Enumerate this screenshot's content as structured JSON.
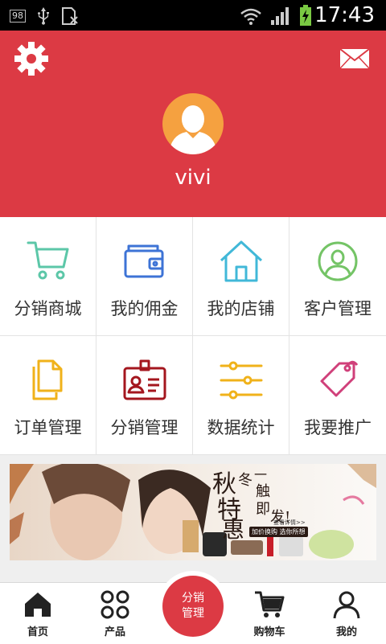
{
  "status_bar": {
    "time": "17:43",
    "notification_badge": "98"
  },
  "header": {
    "username": "vivi",
    "settings_icon": "gear-icon",
    "message_icon": "envelope-icon"
  },
  "menu": [
    {
      "label": "分销商城",
      "icon": "shopping-cart-icon",
      "color": "#5cc7a8"
    },
    {
      "label": "我的佣金",
      "icon": "wallet-icon",
      "color": "#3d73d6"
    },
    {
      "label": "我的店铺",
      "icon": "house-icon",
      "color": "#41b8d8"
    },
    {
      "label": "客户管理",
      "icon": "user-circle-icon",
      "color": "#74c466"
    },
    {
      "label": "订单管理",
      "icon": "documents-icon",
      "color": "#f0b21a"
    },
    {
      "label": "分销管理",
      "icon": "id-badge-icon",
      "color": "#a4161e"
    },
    {
      "label": "数据统计",
      "icon": "sliders-icon",
      "color": "#f0b21a"
    },
    {
      "label": "我要推广",
      "icon": "tag-icon",
      "color": "#d0407a"
    }
  ],
  "banner": {
    "title_chars": [
      "秋",
      "冬",
      "特",
      "惠",
      "一",
      "触",
      "即",
      "发!"
    ],
    "small_text": "查看详情>>",
    "button_text": "加价换购 选你所想"
  },
  "bottom_nav": [
    {
      "label": "首页",
      "icon": "home-icon"
    },
    {
      "label": "产品",
      "icon": "grid-icon"
    },
    {
      "label": "分销\n管理",
      "icon": ""
    },
    {
      "label": "购物车",
      "icon": "cart-icon"
    },
    {
      "label": "我的",
      "icon": "person-icon"
    }
  ]
}
